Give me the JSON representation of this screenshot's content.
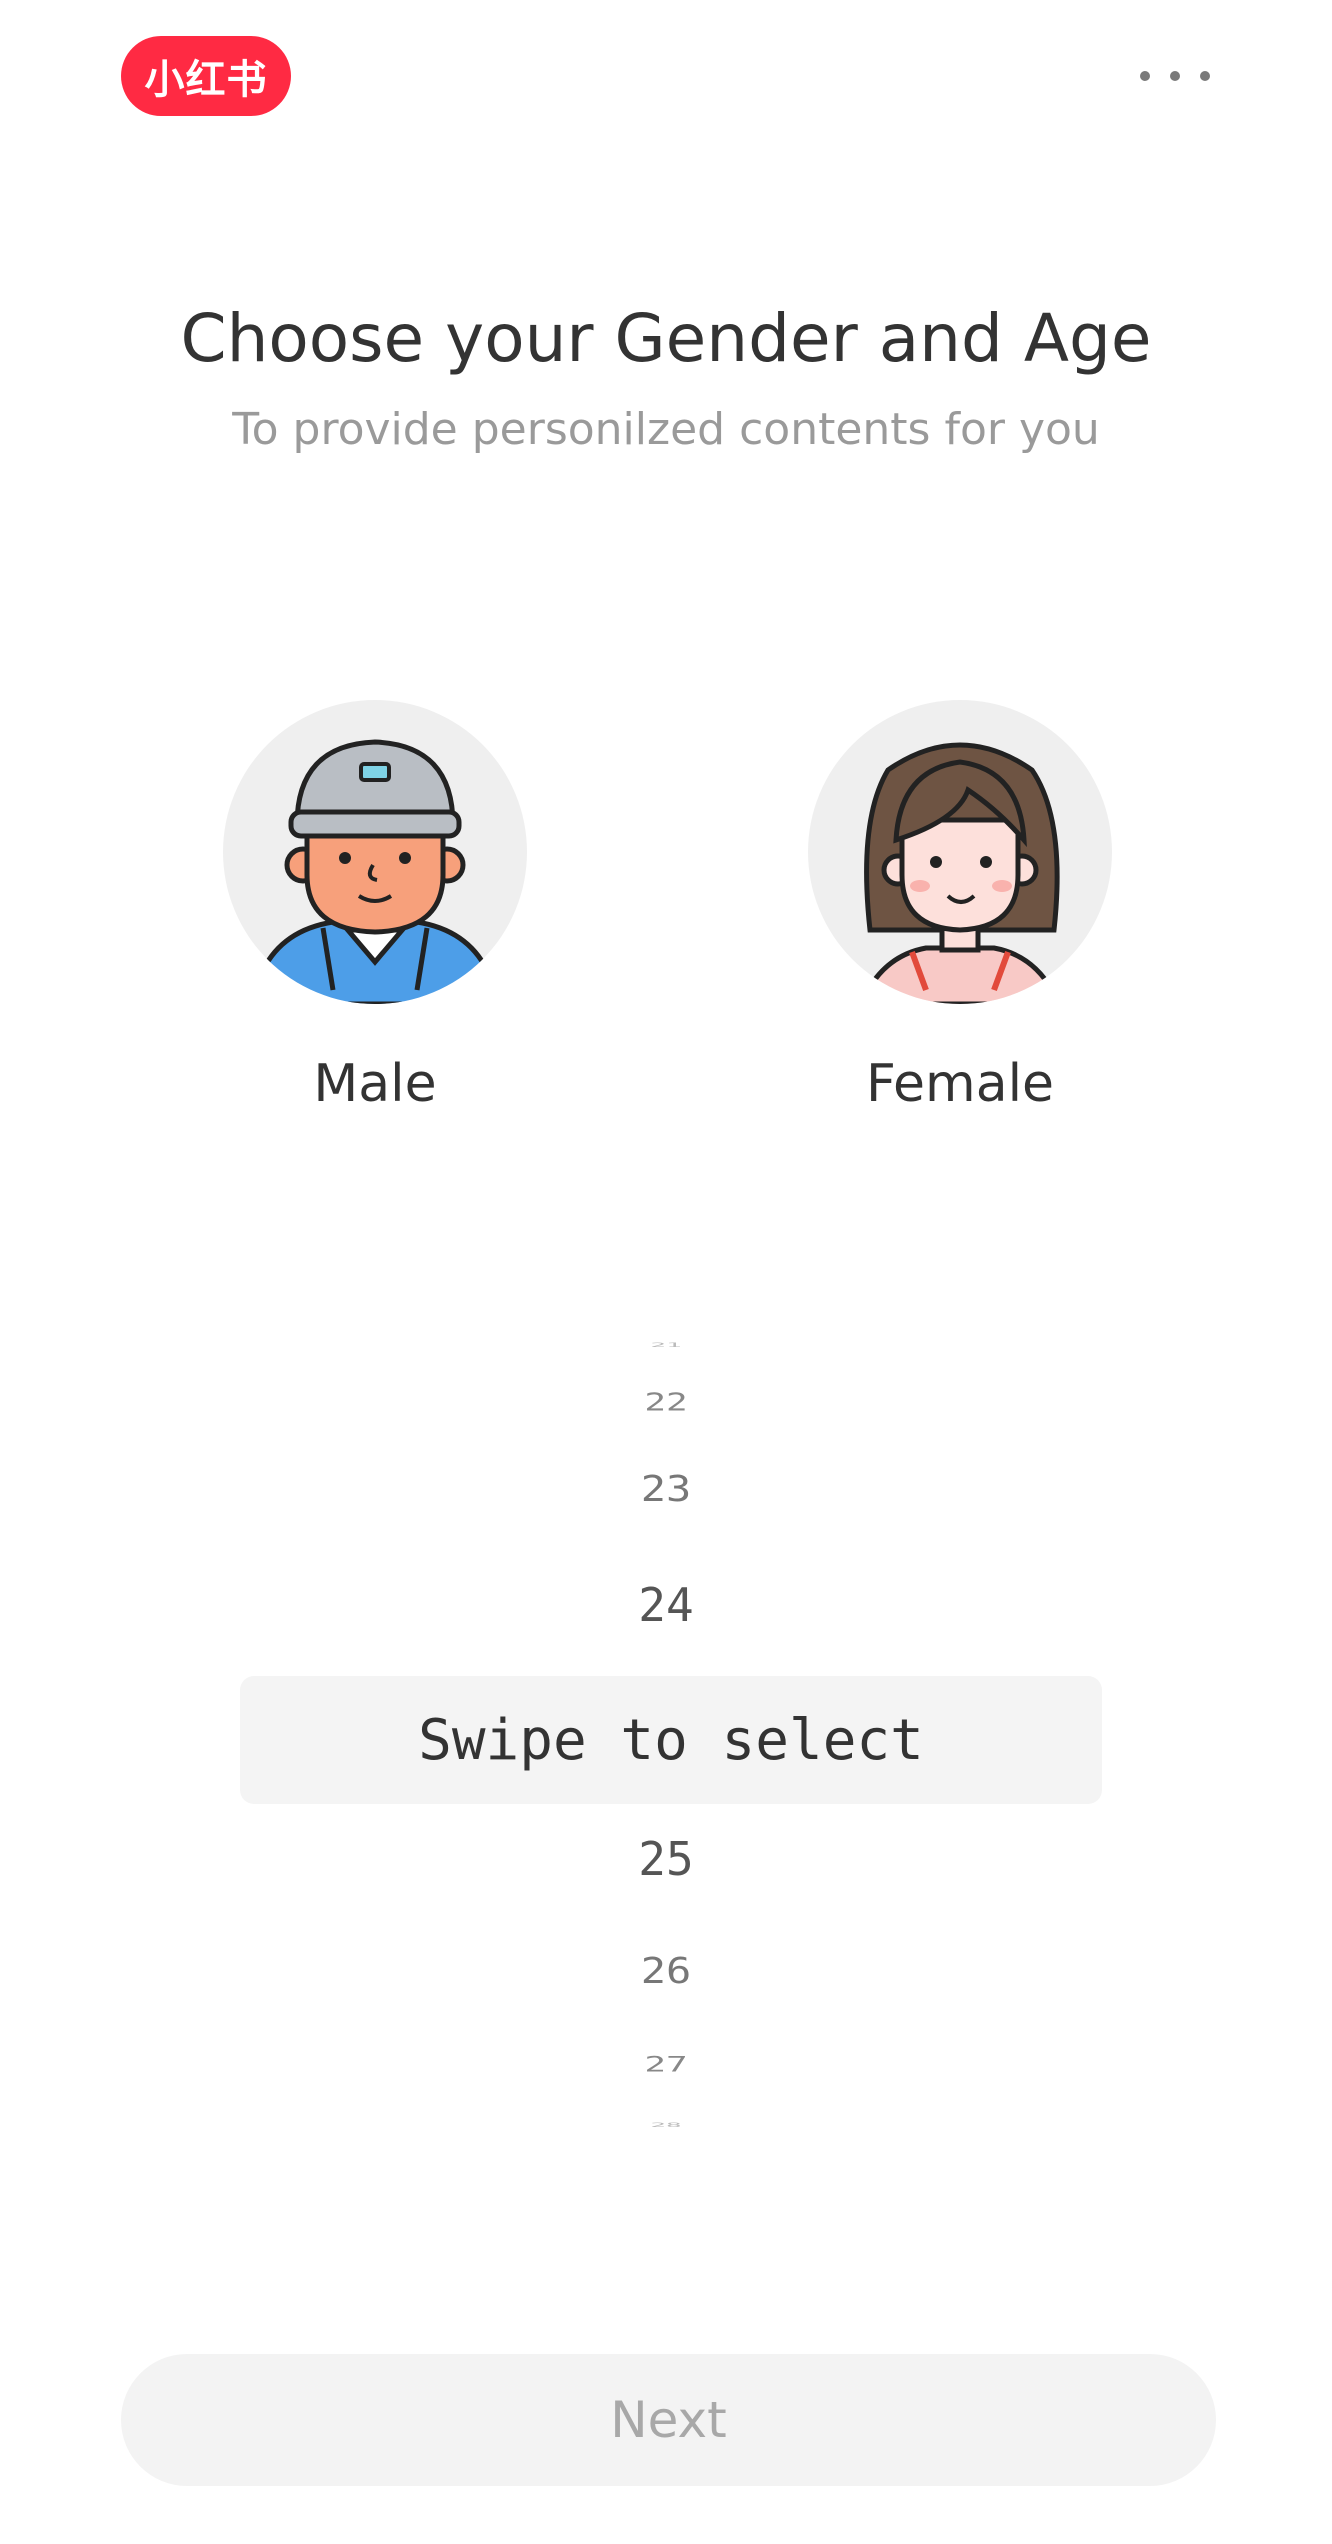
{
  "header": {
    "logo_text": "小红书",
    "logo_color": "#ff2a43",
    "more_icon": "more-horizontal-icon"
  },
  "content": {
    "title": "Choose your Gender and Age",
    "subtitle": "To provide personilzed contents for you"
  },
  "gender": {
    "options": [
      {
        "label": "Male",
        "icon": "male-avatar-icon"
      },
      {
        "label": "Female",
        "icon": "female-avatar-icon"
      }
    ]
  },
  "age_picker": {
    "values": [
      "21",
      "22",
      "23",
      "24",
      "25",
      "26",
      "27",
      "28"
    ],
    "hint": "Swipe to select"
  },
  "footer": {
    "next_label": "Next"
  }
}
